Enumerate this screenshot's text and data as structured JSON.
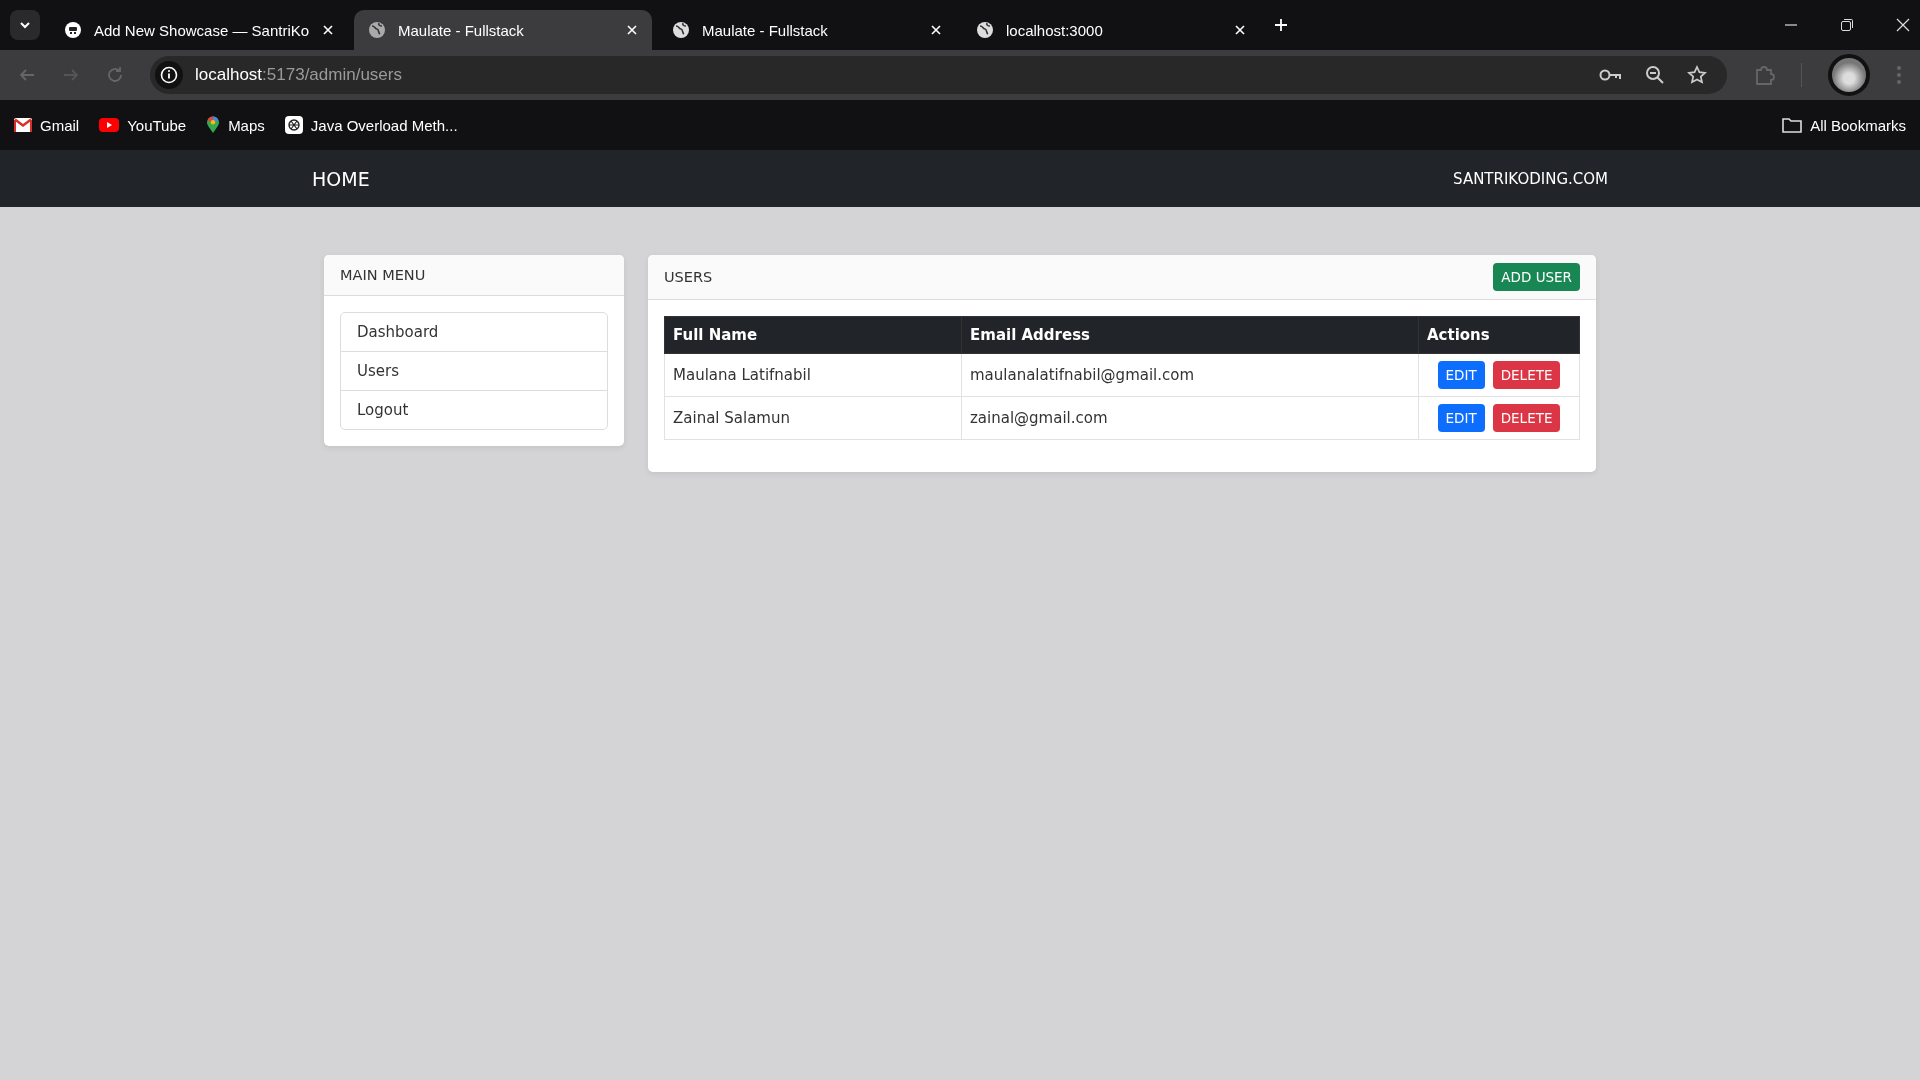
{
  "browser": {
    "tabs": [
      {
        "title": "Add New Showcase — SantriKo",
        "kind": "site",
        "selected": false
      },
      {
        "title": "Maulate - Fullstack",
        "kind": "globe",
        "selected": true
      },
      {
        "title": "Maulate - Fullstack",
        "kind": "globe",
        "selected": false
      },
      {
        "title": "localhost:3000",
        "kind": "globe",
        "selected": false
      }
    ],
    "address": {
      "host": "localhost",
      "path": ":5173/admin/users"
    },
    "bookmarks": [
      {
        "label": "Gmail",
        "kind": "mail"
      },
      {
        "label": "YouTube",
        "kind": "video"
      },
      {
        "label": "Maps",
        "kind": "pin"
      },
      {
        "label": "Java Overload Meth...",
        "kind": "knot"
      }
    ],
    "all_bookmarks": "All Bookmarks"
  },
  "navbar": {
    "home": "HOME",
    "brand": "SANTRIKODING.COM"
  },
  "sidebar": {
    "title": "MAIN MENU",
    "items": [
      "Dashboard",
      "Users",
      "Logout"
    ]
  },
  "users": {
    "title": "USERS",
    "add_button": "ADD USER",
    "table": {
      "columns": [
        "Full Name",
        "Email Address",
        "Actions"
      ],
      "rows": [
        {
          "name": "Maulana Latifnabil",
          "email": "maulanalatifnabil@gmail.com",
          "actions": [
            {
              "label": "EDIT",
              "kind": "edit"
            },
            {
              "label": "DELETE",
              "kind": "delete"
            }
          ]
        },
        {
          "name": "Zainal Salamun",
          "email": "zainal@gmail.com",
          "actions": [
            {
              "label": "EDIT",
              "kind": "edit"
            },
            {
              "label": "DELETE",
              "kind": "delete"
            }
          ]
        }
      ]
    }
  }
}
